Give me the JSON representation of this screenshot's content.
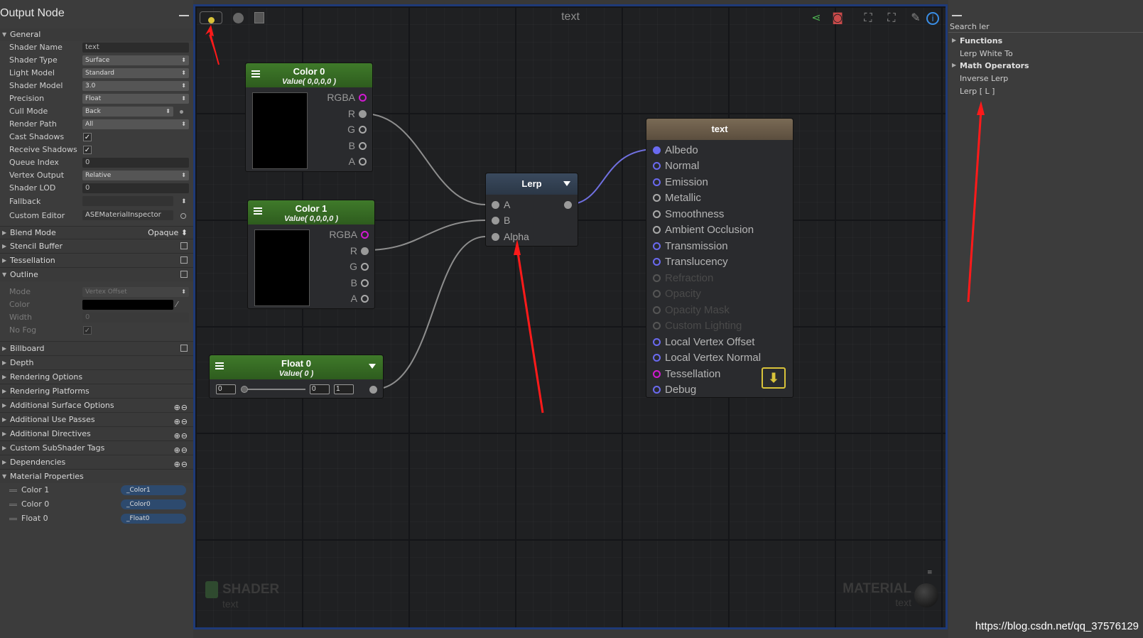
{
  "left_panel": {
    "title": "Output Node",
    "general": "General",
    "fields": [
      {
        "label": "Shader Name",
        "value": "text"
      },
      {
        "label": "Shader Type",
        "value": "Surface"
      },
      {
        "label": "Light Model",
        "value": "Standard"
      },
      {
        "label": "Shader Model",
        "value": "3.0"
      },
      {
        "label": "Precision",
        "value": "Float"
      },
      {
        "label": "Cull Mode",
        "value": "Back"
      },
      {
        "label": "Render Path",
        "value": "All"
      },
      {
        "label": "Cast Shadows",
        "value": "✓"
      },
      {
        "label": "Receive Shadows",
        "value": "✓"
      },
      {
        "label": "Queue Index",
        "value": "0"
      },
      {
        "label": "Vertex Output",
        "value": "Relative"
      },
      {
        "label": "Shader LOD",
        "value": "0"
      },
      {
        "label": "Fallback",
        "value": ""
      },
      {
        "label": "Custom Editor",
        "value": "ASEMaterialInspector"
      }
    ],
    "blend_mode": {
      "label": "Blend Mode",
      "value": "Opaque"
    },
    "stencil": "Stencil Buffer",
    "tessellation": "Tessellation",
    "outline": "Outline",
    "outline_fields": [
      {
        "label": "Mode",
        "value": "Vertex Offset"
      },
      {
        "label": "Color",
        "value": ""
      },
      {
        "label": "Width",
        "value": "0"
      },
      {
        "label": "No Fog",
        "value": "✓"
      }
    ],
    "sections": [
      "Billboard",
      "Depth",
      "Rendering Options",
      "Rendering Platforms"
    ],
    "pm_sections": [
      "Additional Surface Options",
      "Additional Use Passes",
      "Additional Directives",
      "Custom SubShader Tags",
      "Dependencies"
    ],
    "material_properties": "Material Properties",
    "props": [
      {
        "label": "Color 1",
        "value": "_Color1"
      },
      {
        "label": "Color 0",
        "value": "_Color0"
      },
      {
        "label": "Float 0",
        "value": "_Float0"
      }
    ]
  },
  "canvas": {
    "title": "text",
    "shader_label": "SHADER",
    "shader_name": "text",
    "material_label": "MATERIAL",
    "material_name": "text",
    "nodes": {
      "color0": {
        "title": "Color 0",
        "sub": "Value( 0,0,0,0 )",
        "ports": [
          "RGBA",
          "R",
          "G",
          "B",
          "A"
        ]
      },
      "color1": {
        "title": "Color 1",
        "sub": "Value( 0,0,0,0 )",
        "ports": [
          "RGBA",
          "R",
          "G",
          "B",
          "A"
        ]
      },
      "float0": {
        "title": "Float 0",
        "sub": "Value( 0 )",
        "value": "0",
        "min": "0",
        "max": "1"
      },
      "lerp": {
        "title": "Lerp",
        "inputs": [
          "A",
          "B",
          "Alpha"
        ]
      },
      "output": {
        "title": "text",
        "inputs": [
          "Albedo",
          "Normal",
          "Emission",
          "Metallic",
          "Smoothness",
          "Ambient Occlusion",
          "Transmission",
          "Translucency",
          "Refraction",
          "Opacity",
          "Opacity Mask",
          "Custom Lighting",
          "Local Vertex Offset",
          "Local Vertex Normal",
          "Tessellation",
          "Debug"
        ]
      }
    }
  },
  "right_panel": {
    "search": "Search ler",
    "items": [
      "Functions",
      "Lerp White To",
      "Math Operators",
      "Inverse Lerp",
      "Lerp [ L ]"
    ]
  },
  "url": "https://blog.csdn.net/qq_37576129",
  "colors": {
    "accent_blue": "#1e3a78",
    "node_green": "#3f7a2a",
    "red_arrow": "#ff1a1a"
  }
}
